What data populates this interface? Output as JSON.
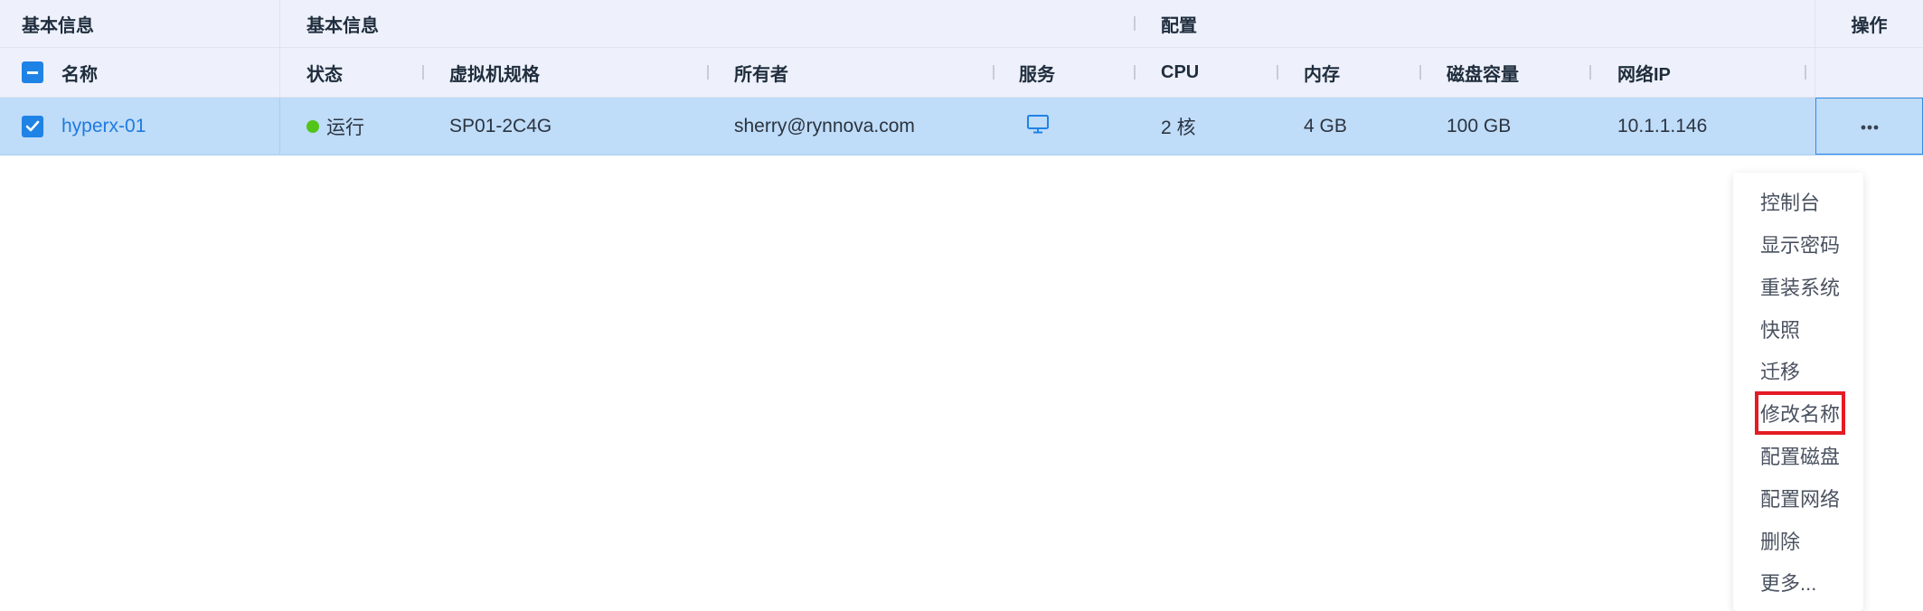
{
  "groups": {
    "basic_info_1": "基本信息",
    "basic_info_2": "基本信息",
    "config": "配置",
    "ops": "操作"
  },
  "columns": {
    "name": "名称",
    "status": "状态",
    "spec": "虚拟机规格",
    "owner": "所有者",
    "service": "服务",
    "cpu": "CPU",
    "memory": "内存",
    "disk": "磁盘容量",
    "ip": "网络IP"
  },
  "row": {
    "checked": true,
    "name": "hyperx-01",
    "status": "运行",
    "status_color": "#52c41a",
    "spec": "SP01-2C4G",
    "owner": "sherry@rynnova.com",
    "service_icon": "monitor-icon",
    "cpu": "2 核",
    "memory": "4 GB",
    "disk": "100 GB",
    "ip": "10.1.1.146",
    "more_icon": "ellipsis-icon"
  },
  "menu": {
    "items": [
      "控制台",
      "显示密码",
      "重装系统",
      "快照",
      "迁移",
      "修改名称",
      "配置磁盘",
      "配置网络",
      "删除",
      "更多..."
    ],
    "highlighted_item": "修改名称",
    "highlight_color": "#e51b24"
  },
  "colors": {
    "accent": "#1f83e6",
    "selected_row": "#bfdcf8",
    "header_bg": "#eef1fb"
  }
}
